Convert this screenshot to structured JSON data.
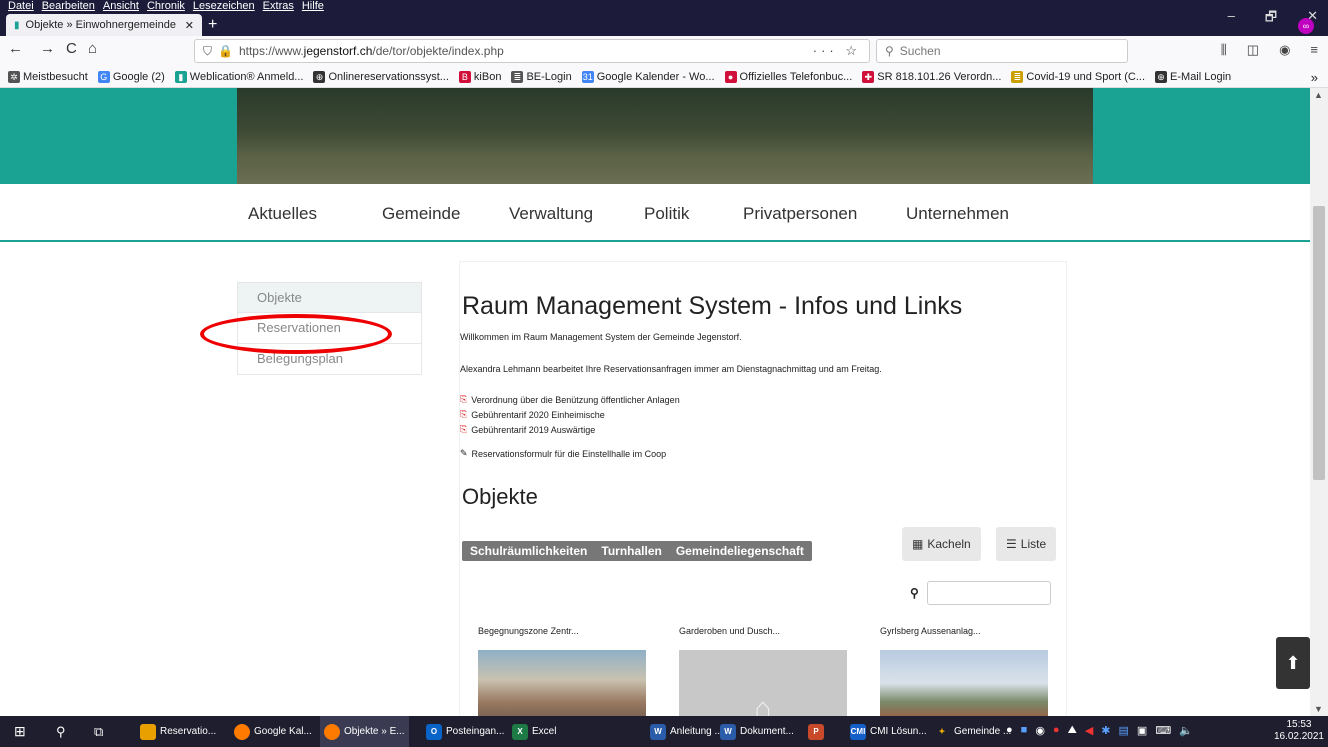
{
  "browser": {
    "menu": [
      "Datei",
      "Bearbeiten",
      "Ansicht",
      "Chronik",
      "Lesezeichen",
      "Extras",
      "Hilfe"
    ],
    "tab_title": "Objekte » Einwohnergemeinde",
    "new_tab": "+",
    "window_controls": [
      "–",
      "🗗",
      "✕"
    ],
    "nav": {
      "back": "←",
      "forward": "→",
      "reload": "C",
      "home": "⌂"
    },
    "url_prefix": "https://www.",
    "url_domain": "jegenstorf.ch",
    "url_path": "/de/tor/objekte/index.php",
    "url_actions": "··· ☆",
    "search_placeholder": "Suchen",
    "bookmarks": [
      {
        "label": "Meistbesucht",
        "color": "#555",
        "glyph": "✲"
      },
      {
        "label": "Google (2)",
        "color": "#4285f4",
        "glyph": "G"
      },
      {
        "label": "Weblication® Anmeld...",
        "color": "#1aa292",
        "glyph": "▮"
      },
      {
        "label": "Onlinereservationssyst...",
        "color": "#333",
        "glyph": "⊕"
      },
      {
        "label": "kiBon",
        "color": "#d0103a",
        "glyph": "B"
      },
      {
        "label": "BE-Login",
        "color": "#555",
        "glyph": "≣"
      },
      {
        "label": "Google Kalender - Wo...",
        "color": "#4285f4",
        "glyph": "31"
      },
      {
        "label": "Offizielles Telefonbuc...",
        "color": "#d0103a",
        "glyph": "●"
      },
      {
        "label": "SR 818.101.26 Verordn...",
        "color": "#d0103a",
        "glyph": "✚"
      },
      {
        "label": "Covid-19 und Sport (C...",
        "color": "#c9a000",
        "glyph": "≣"
      },
      {
        "label": "E-Mail Login",
        "color": "#333",
        "glyph": "⊕"
      }
    ],
    "bookmarks_more": "»"
  },
  "site": {
    "nav": [
      "Aktuelles",
      "Gemeinde",
      "Verwaltung",
      "Politik",
      "Privatpersonen",
      "Unternehmen"
    ],
    "sidebar": [
      "Objekte",
      "Reservationen",
      "Belegungsplan"
    ],
    "heading": "Raum Management System - Infos und Links",
    "welcome": "Willkommen im Raum Management System der Gemeinde Jegenstorf.",
    "info": "Alexandra Lehmann bearbeitet Ihre Reservationsanfragen immer am Dienstagnachmittag und am Freitag.",
    "documents": [
      "Verordnung über die Benützung öffentlicher Anlagen",
      "Gebührentarif 2020 Einheimische",
      "Gebührentarif 2019 Auswärtige"
    ],
    "form_link": "Reservationsformulr für die Einstellhalle im Coop",
    "objects_heading": "Objekte",
    "filters": [
      "Schulräumlichkeiten",
      "Turnhallen",
      "Gemeindeliegenschaft"
    ],
    "view_tiles": "Kacheln",
    "view_list": "Liste",
    "tiles": [
      "Begegnungszone Zentr...",
      "Garderoben und Dusch...",
      "Gyrlsberg Aussenanlag..."
    ]
  },
  "taskbar": {
    "items": [
      "Reservatio...",
      "Google Kal...",
      "Objekte » E...",
      "Posteingan...",
      "Excel",
      "Anleitung ...",
      "Dokument...",
      "CMI Lösun...",
      "Gemeinde ..."
    ],
    "time": "15:53",
    "date": "16.02.2021"
  }
}
